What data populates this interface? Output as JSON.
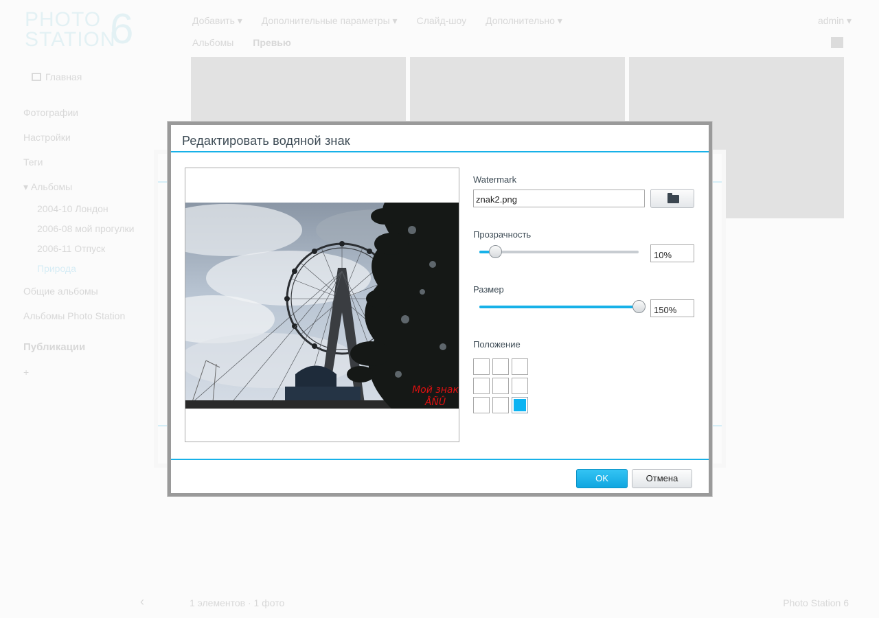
{
  "background": {
    "logo_line1": "PHOTO",
    "logo_line2": "STATION",
    "logo_version": "6",
    "topnav": [
      "Добавить ▾",
      "Дополнительные параметры ▾",
      "Слайд-шоу",
      "Дополнительно ▾"
    ],
    "subnav": [
      "Альбомы",
      "Превью"
    ],
    "user": "admin ▾",
    "sidebar": {
      "home": "Главная",
      "items": [
        "Фотографии",
        "Настройки",
        "Теги"
      ],
      "albums_label": "▾ Альбомы",
      "albums": [
        "2004-10 Лондон",
        "2006-08 мой прогулки",
        "2006-11 Отпуск",
        "Природа"
      ],
      "extra": [
        "Общие альбомы",
        "Альбомы Photo Station"
      ],
      "section": "Публикации",
      "add": "+"
    },
    "bottombar": "1 элементов · 1 фото",
    "bottomright": "Photo Station 6"
  },
  "modal": {
    "title": "Редактировать водяной знак",
    "watermark_label": "Watermark",
    "watermark_file": "znak2.png",
    "opacity_label": "Прозрачность",
    "opacity_value": "10%",
    "opacity_fraction": 0.1,
    "size_label": "Размер",
    "size_value": "150%",
    "size_fraction": 1.0,
    "position_label": "Положение",
    "position_selected": "bottom-right",
    "watermark_text_line1": "Мой знак",
    "watermark_text_line2": "ÅÑÛ",
    "ok_label": "OK",
    "cancel_label": "Отмена",
    "accent_color": "#17b1e8"
  }
}
